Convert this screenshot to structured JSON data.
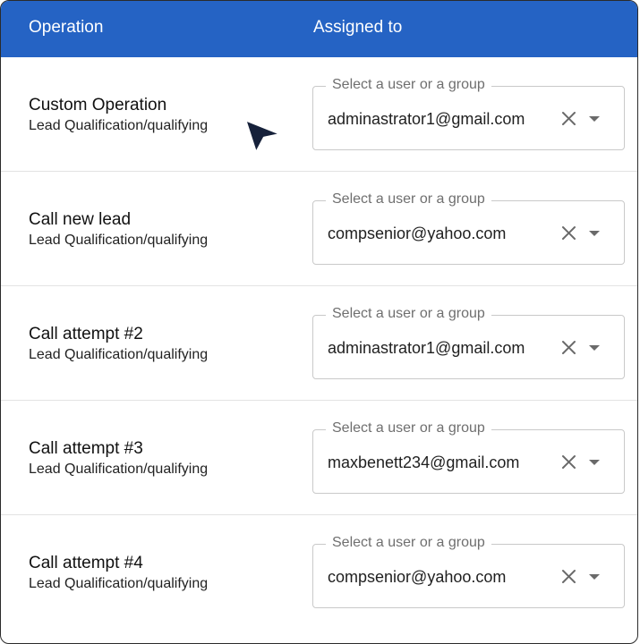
{
  "header": {
    "col_operation": "Operation",
    "col_assigned": "Assigned to"
  },
  "rows": [
    {
      "title": "Custom Operation",
      "subtitle": "Lead Qualification/qualifying",
      "field_label": "Select a user or a group",
      "value": "adminastrator1@gmail.com"
    },
    {
      "title": "Call new lead",
      "subtitle": "Lead Qualification/qualifying",
      "field_label": "Select a user or a group",
      "value": "compsenior@yahoo.com"
    },
    {
      "title": "Call attempt #2",
      "subtitle": "Lead Qualification/qualifying",
      "field_label": "Select a user or a group",
      "value": "adminastrator1@gmail.com"
    },
    {
      "title": "Call attempt #3",
      "subtitle": "Lead Qualification/qualifying",
      "field_label": "Select a user or a group",
      "value": "maxbenett234@gmail.com"
    },
    {
      "title": "Call attempt #4",
      "subtitle": "Lead Qualification/qualifying",
      "field_label": "Select a user or a group",
      "value": "compsenior@yahoo.com"
    }
  ],
  "icons": {
    "clear": "close-icon",
    "dropdown": "caret-down-icon",
    "pointer": "mouse-pointer-icon"
  },
  "colors": {
    "header_bg": "#2563c4",
    "header_text": "#ffffff",
    "border": "#c9c9c9",
    "cursor": "#16213a"
  }
}
